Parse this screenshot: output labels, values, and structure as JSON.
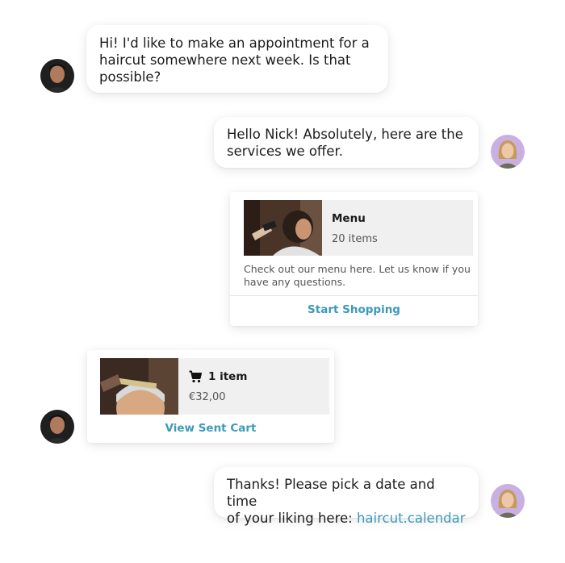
{
  "conversation": {
    "msg1": {
      "line1": "Hi! I'd like to make an appointment for a",
      "line2": "haircut somewhere next week. Is that",
      "line3": "possible?"
    },
    "msg2": {
      "line1": "Hello Nick! Absolutely, here are the",
      "line2": "services we offer."
    },
    "menu_card": {
      "title": "Menu",
      "count": "20 items",
      "desc_line1": "Check out our menu here. Let us know if you",
      "desc_line2": "have any questions.",
      "action": "Start Shopping"
    },
    "cart_card": {
      "title": "1 item",
      "price": "€32,00",
      "action": "View Sent Cart"
    },
    "msg3": {
      "line1": "Thanks! Please pick a date and time",
      "line2_prefix": "of your liking here: ",
      "link": "haircut.calendar"
    }
  },
  "colors": {
    "accent": "#3d9ab8",
    "card_header_bg": "#f0f0f0",
    "business_avatar_bg": "#c9b0e2",
    "customer_avatar_bg": "#1f1f1f"
  },
  "icons": {
    "cart": "shopping-cart-icon"
  }
}
